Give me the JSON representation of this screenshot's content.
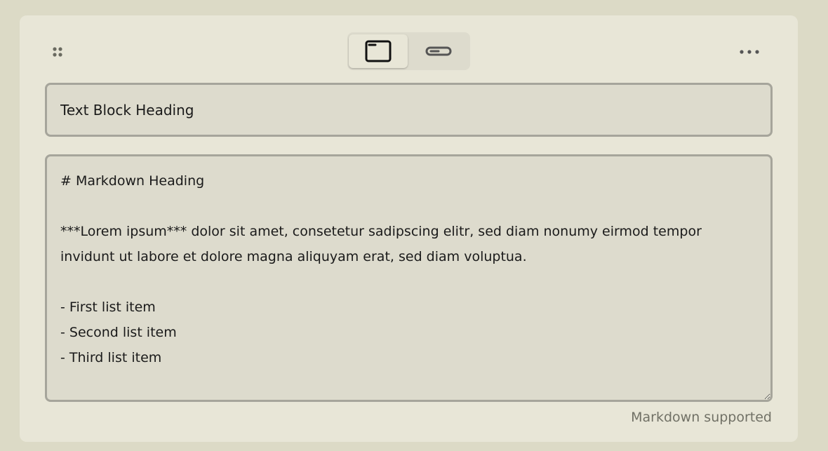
{
  "toolbar": {
    "drag_icon": "drag-handle-icon",
    "view_options": [
      {
        "name": "block",
        "icon": "window-icon",
        "selected": true
      },
      {
        "name": "inline",
        "icon": "inline-bar-icon",
        "selected": false
      }
    ],
    "more_icon": "more-horizontal-icon"
  },
  "heading_field": {
    "value": "Text Block Heading"
  },
  "body_field": {
    "value": "# Markdown Heading\n\n***Lorem ipsum*** dolor sit amet, consetetur sadipscing elitr, sed diam nonumy eirmod tempor invidunt ut labore et dolore magna aliquyam erat, sed diam voluptua.\n\n- First list item\n- Second list item\n- Third list item"
  },
  "footer": {
    "hint": "Markdown supported"
  },
  "colors": {
    "page_bg": "#dcdac6",
    "card_bg": "#e8e6d7",
    "field_bg": "#dddbcd",
    "field_border": "#a6a59b",
    "text": "#1a1a1a",
    "muted_text": "#717166"
  }
}
